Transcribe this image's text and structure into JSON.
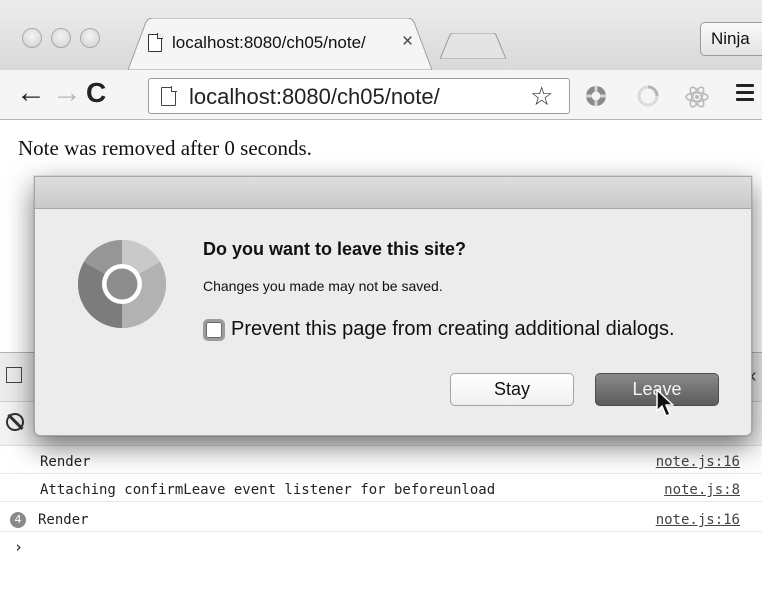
{
  "browser": {
    "tab": {
      "title": "localhost:8080/ch05/note/",
      "close_glyph": "×",
      "favicon": "document-icon"
    },
    "profile_button": "Ninja",
    "toolbar": {
      "back_glyph": "←",
      "forward_glyph": "→",
      "reload_glyph": "C",
      "url": "localhost:8080/ch05/note/",
      "bookmark_glyph": "☆"
    },
    "extensions": [
      "lifebuoy-icon",
      "spinner-icon",
      "react-atom-icon"
    ],
    "menu_icon": "hamburger-menu-icon"
  },
  "page": {
    "text": "Note was removed after 0 seconds."
  },
  "dialog": {
    "title": "Do you want to leave this site?",
    "message": "Changes you made may not be saved.",
    "checkbox_label": "Prevent this page from creating additional dialogs.",
    "checkbox_checked": false,
    "stay_label": "Stay",
    "leave_label": "Leave",
    "icon": "chrome-logo-icon"
  },
  "devtools": {
    "console": {
      "messages": [
        {
          "text": "Render",
          "source": "note.js:16",
          "count": null
        },
        {
          "text": "Attaching confirmLeave event listener for beforeunload",
          "source": "note.js:8",
          "count": null
        },
        {
          "text": "Render",
          "source": "note.js:16",
          "count": "4"
        }
      ],
      "prompt": "›"
    }
  },
  "colors": {
    "leave_button": "#6e6e6e",
    "dialog_bg": "#ececec"
  }
}
